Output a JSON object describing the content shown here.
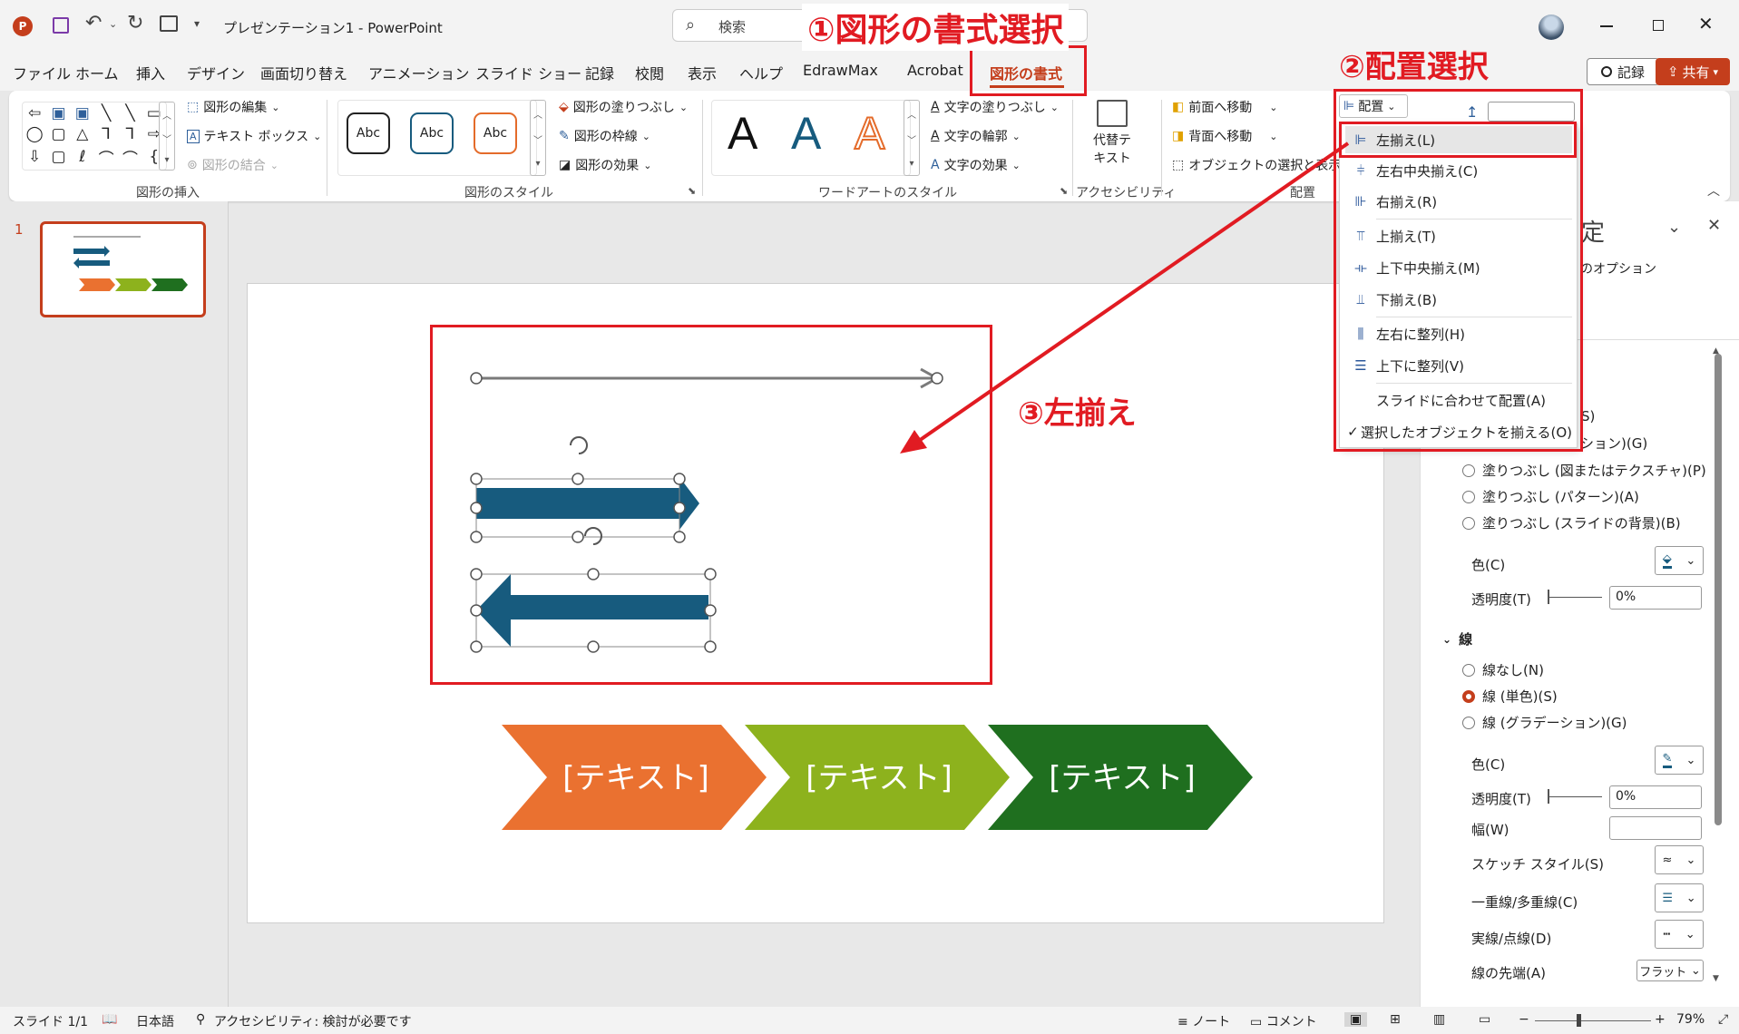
{
  "title_bar": {
    "document_title": "プレゼンテーション1",
    "separator": " - ",
    "app_name": "PowerPoint",
    "search_placeholder": "検索"
  },
  "tabs": [
    {
      "label": "ファイル"
    },
    {
      "label": "ホーム"
    },
    {
      "label": "挿入"
    },
    {
      "label": "デザイン"
    },
    {
      "label": "画面切り替え"
    },
    {
      "label": "アニメーション"
    },
    {
      "label": "スライド ショー"
    },
    {
      "label": "記録"
    },
    {
      "label": "校閲"
    },
    {
      "label": "表示"
    },
    {
      "label": "ヘルプ"
    },
    {
      "label": "EdrawMax"
    },
    {
      "label": "Acrobat"
    },
    {
      "label": "図形の書式"
    }
  ],
  "record_button": "記録",
  "share_button": "共有",
  "ribbon": {
    "insert_shapes": {
      "label": "図形の挿入",
      "edit_shape": "図形の編集",
      "text_box": "テキスト ボックス",
      "merge_shapes": "図形の結合"
    },
    "shape_styles": {
      "label": "図形のスタイル",
      "sample": "Abc",
      "fill": "図形の塗りつぶし",
      "outline": "図形の枠線",
      "effects": "図形の効果"
    },
    "wordart": {
      "label": "ワードアートのスタイル",
      "sample": "A",
      "text_fill": "文字の塗りつぶし",
      "text_outline": "文字の輪郭",
      "text_effects": "文字の効果"
    },
    "accessibility": {
      "label": "アクセシビリティ",
      "alt_text_line1": "代替テ",
      "alt_text_line2": "キスト"
    },
    "arrange": {
      "label": "配置",
      "bring_forward": "前面へ移動",
      "send_backward": "背面へ移動",
      "selection_pane": "オブジェクトの選択と表示",
      "align_button": "配置"
    }
  },
  "align_menu": {
    "items": [
      {
        "label": "左揃え(L)",
        "icon": "align-left-icon"
      },
      {
        "label": "左右中央揃え(C)",
        "icon": "align-center-icon"
      },
      {
        "label": "右揃え(R)",
        "icon": "align-right-icon"
      },
      {
        "label": "上揃え(T)",
        "icon": "align-top-icon"
      },
      {
        "label": "上下中央揃え(M)",
        "icon": "align-middle-icon"
      },
      {
        "label": "下揃え(B)",
        "icon": "align-bottom-icon"
      },
      {
        "label": "左右に整列(H)",
        "icon": "distribute-horizontal-icon"
      },
      {
        "label": "上下に整列(V)",
        "icon": "distribute-vertical-icon"
      },
      {
        "label": "スライドに合わせて配置(A)",
        "icon": ""
      },
      {
        "label": "選択したオブジェクトを揃える(O)",
        "icon": "check-icon"
      }
    ]
  },
  "annotations": {
    "step1": "①図形の書式選択",
    "step2": "②配置選択",
    "step3": "③左揃え",
    "color": "#e11b22"
  },
  "slide_panel": {
    "slide_number": "1"
  },
  "slide": {
    "chevrons": [
      {
        "text": "[テキスト]",
        "color": "#ea7130"
      },
      {
        "text": "[テキスト]",
        "color": "#8db21d"
      },
      {
        "text": "[テキスト]",
        "color": "#1f6f1f"
      }
    ],
    "arrow_color": "#175b7e"
  },
  "format_pane": {
    "title_partial": "定",
    "options_partial": "のオプション",
    "fill_partial_1": "S)",
    "fill_partial_2": "ション)(G)",
    "fill_picture": "塗りつぶし (図またはテクスチャ)(P)",
    "fill_pattern": "塗りつぶし (パターン)(A)",
    "fill_background": "塗りつぶし (スライドの背景)(B)",
    "color_label": "色(C)",
    "transparency_label": "透明度(T)",
    "transparency_value": "0%",
    "line_section": "線",
    "line_none": "線なし(N)",
    "line_solid": "線 (単色)(S)",
    "line_gradient": "線 (グラデーション)(G)",
    "line_color_label": "色(C)",
    "line_transparency_label": "透明度(T)",
    "line_transparency_value": "0%",
    "width_label": "幅(W)",
    "sketch_label": "スケッチ スタイル(S)",
    "compound_label": "一重線/多重線(C)",
    "dash_label": "実線/点線(D)",
    "cap_label": "線の先端(A)",
    "cap_value": "フラット"
  },
  "status_bar": {
    "slide_info": "スライド 1/1",
    "language": "日本語",
    "accessibility": "アクセシビリティ: 検討が必要です",
    "notes": "ノート",
    "comments": "コメント",
    "zoom": "79%"
  }
}
